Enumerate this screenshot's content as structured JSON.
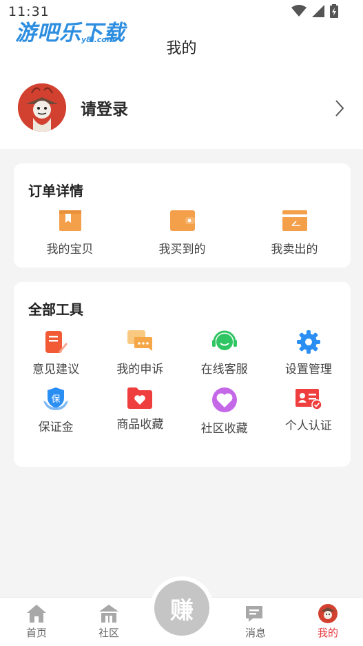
{
  "status_bar": {
    "time": "11:31",
    "icons": [
      "wifi-icon",
      "signal-icon",
      "battery-icon"
    ]
  },
  "watermark": {
    "text": "游吧乐下载",
    "sub": "y8l.com"
  },
  "header": {
    "title": "我的"
  },
  "profile": {
    "login_label": "请登录"
  },
  "orders": {
    "title": "订单详情",
    "items": [
      {
        "label": "我的宝贝",
        "icon": "bookmark-box-icon"
      },
      {
        "label": "我买到的",
        "icon": "wallet-icon"
      },
      {
        "label": "我卖出的",
        "icon": "sold-card-icon"
      }
    ]
  },
  "tools": {
    "title": "全部工具",
    "items": [
      {
        "label": "意见建议",
        "icon": "feedback-edit-icon"
      },
      {
        "label": "我的申诉",
        "icon": "chat-bubbles-icon"
      },
      {
        "label": "在线客服",
        "icon": "headset-icon"
      },
      {
        "label": "设置管理",
        "icon": "gear-icon"
      },
      {
        "label": "保证金",
        "icon": "deposit-shield-icon"
      },
      {
        "label": "商品收藏",
        "icon": "heart-folder-icon"
      },
      {
        "label": "社区收藏",
        "icon": "heart-circle-icon"
      },
      {
        "label": "个人认证",
        "icon": "id-card-icon"
      }
    ]
  },
  "tabbar": {
    "items": [
      {
        "label": "首页",
        "icon": "home-icon"
      },
      {
        "label": "社区",
        "icon": "community-icon"
      },
      {
        "label": "消息",
        "icon": "message-icon"
      },
      {
        "label": "我的",
        "icon": "avatar-icon",
        "active": true
      }
    ],
    "center": {
      "glyph": "赚",
      "icon": "earn-icon"
    }
  },
  "colors": {
    "accent": "#e5373d",
    "order_icon": "#f4a04b",
    "background": "#f4f4f5",
    "watermark": "#2d8ee0"
  }
}
